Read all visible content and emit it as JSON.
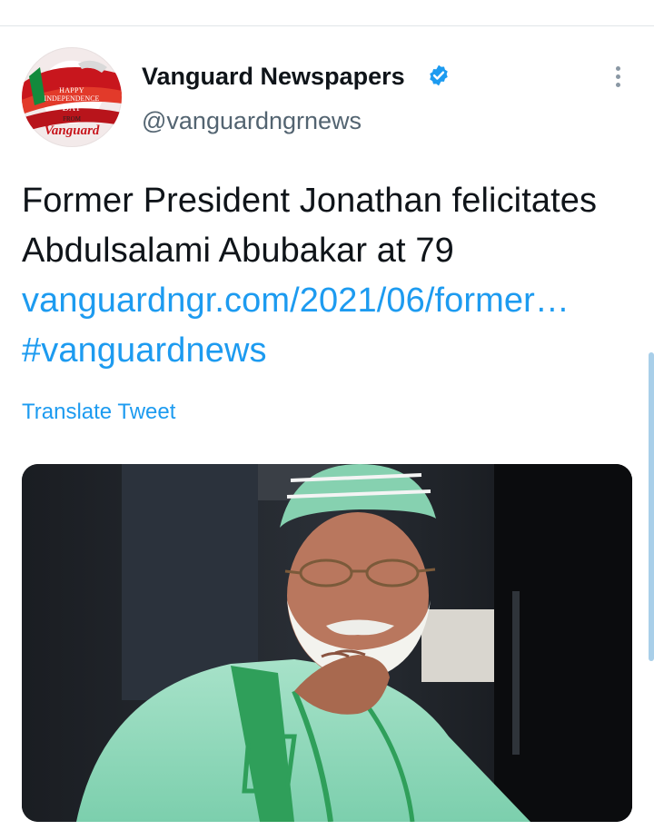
{
  "tweet": {
    "author": {
      "display_name": "Vanguard Newspapers",
      "handle": "@vanguardngrnews",
      "verified_icon": "verified-badge-icon",
      "avatar_lines": [
        "HAPPY",
        "INDEPENDENCE",
        "DAY",
        "FROM",
        "Vanguard"
      ]
    },
    "text_plain": "Former President Jonathan felicitates Abdulsalami Abubakar at 79",
    "link_text": "vanguardngr.com/2021/06/former…",
    "hashtag": "#vanguardnews",
    "translate_label": "Translate Tweet",
    "more_icon": "more-vertical-icon",
    "colors": {
      "accent": "#1d9bf0",
      "text": "#0f1419",
      "secondary": "#536471"
    }
  }
}
